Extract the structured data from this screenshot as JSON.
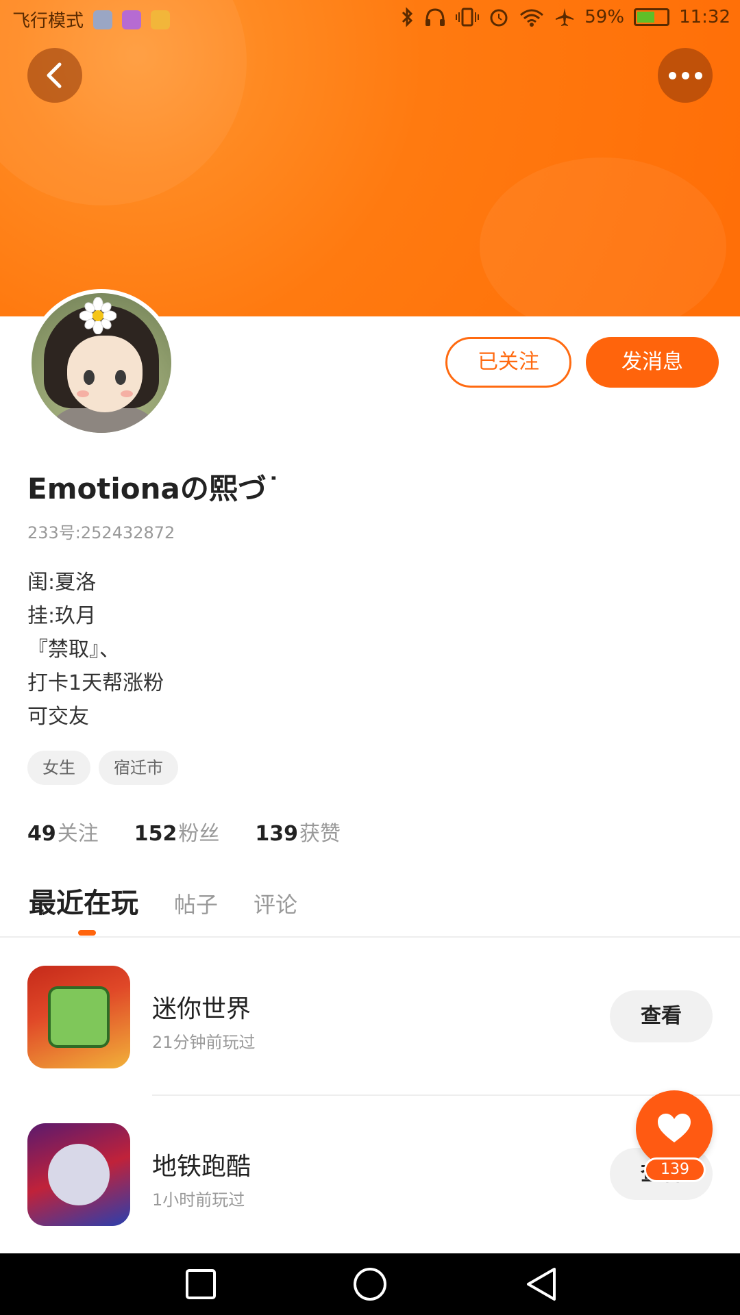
{
  "status_bar": {
    "airplane_mode_text": "飞行模式",
    "battery_percent": "59%",
    "time": "11:32",
    "battery_level": 0.59,
    "icons": [
      "bluetooth-icon",
      "headphones-icon",
      "vibrate-icon",
      "alarm-icon",
      "wifi-icon",
      "airplane-icon"
    ]
  },
  "header": {
    "back_icon": "chevron-left-icon",
    "more_icon": "more-dots-icon",
    "banner_color": "#ff7a10"
  },
  "profile": {
    "username": "Emotionaの熙づ˙",
    "id_text": "233号:252432872",
    "bio_lines": [
      "闺:夏洛",
      "挂:玖月",
      "『禁取』、",
      "打卡1天帮涨粉",
      "可交友"
    ],
    "tags": [
      "女生",
      "宿迁市"
    ],
    "follow_button": "已关注",
    "message_button": "发消息"
  },
  "stats": {
    "following_count": "49",
    "following_label": "关注",
    "fans_count": "152",
    "fans_label": "粉丝",
    "likes_count": "139",
    "likes_label": "获赞"
  },
  "tabs": {
    "active": "最近在玩",
    "posts": "帖子",
    "comments": "评论"
  },
  "games": [
    {
      "title": "迷你世界",
      "subtitle": "21分钟前玩过",
      "button": "查看"
    },
    {
      "title": "地铁跑酷",
      "subtitle": "1小时前玩过",
      "button": "查看"
    }
  ],
  "like_fab": {
    "count": "139",
    "icon": "heart-icon",
    "color": "#ff5a12"
  },
  "accent_color": "#ff640c"
}
